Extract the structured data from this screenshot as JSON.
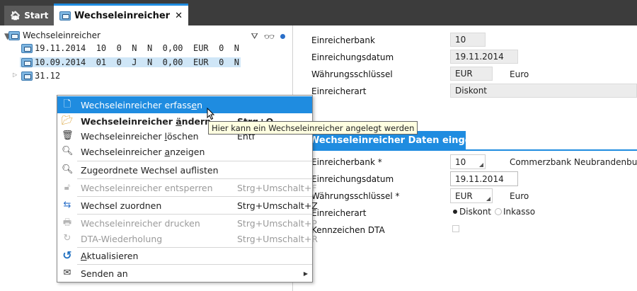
{
  "tabs": {
    "start_label": "Start",
    "active_label": "Wechseleinreicher",
    "close_glyph": "✕"
  },
  "tree": {
    "root_label": "Wechseleinreicher",
    "items": [
      {
        "label": "19.11.2014  10  0  N  N  0,00  EUR  0  N"
      },
      {
        "label": "10.09.2014  01  0  J  N  0,00  EUR  0  N"
      },
      {
        "label": "31.12"
      }
    ]
  },
  "details_top": {
    "bank_label": "Einreicherbank",
    "bank_value": "10",
    "date_label": "Einreichungsdatum",
    "date_value": "19.11.2014",
    "currency_label": "Währungsschlüssel",
    "currency_value": "EUR",
    "currency_name": "Euro",
    "type_label": "Einreicherart",
    "type_value": "Diskont"
  },
  "form": {
    "header": "Wechseleinreicher Daten eingeben",
    "bank_label": "Einreicherbank *",
    "bank_value": "10",
    "bank_name": "Commerzbank Neubrandenburg",
    "date_label": "Einreichungsdatum",
    "date_value": "19.11.2014",
    "currency_label": "Währungsschlüssel *",
    "currency_value": "EUR",
    "currency_name": "Euro",
    "type_label": "Einreicherart",
    "type_option1": "Diskont",
    "type_option2": "Inkasso",
    "dta_label": "Kennzeichen DTA"
  },
  "context_menu": {
    "items": [
      {
        "pre": "Wechseleinreicher erfass",
        "u": "e",
        "post": "n",
        "shortcut": ""
      },
      {
        "pre": "Wechseleinreicher ",
        "u": "ä",
        "post": "ndern",
        "shortcut": "Strg+O"
      },
      {
        "pre": "Wechseleinreicher ",
        "u": "l",
        "post": "öschen",
        "shortcut": "Entf"
      },
      {
        "pre": "Wechseleinreicher ",
        "u": "a",
        "post": "nzeigen",
        "shortcut": ""
      },
      {
        "pre": "Zugeordnete Wechsel auf",
        "u": "l",
        "post": "isten",
        "shortcut": ""
      },
      {
        "pre": "Wechseleinreicher entsperren",
        "u": "",
        "post": "",
        "shortcut": "Strg+Umschalt+F"
      },
      {
        "pre": "Wechsel zuordnen",
        "u": "",
        "post": "",
        "shortcut": "Strg+Umschalt+Z"
      },
      {
        "pre": "Wechseleinreicher drucken",
        "u": "",
        "post": "",
        "shortcut": "Strg+Umschalt+P"
      },
      {
        "pre": "DTA-Wiederholung",
        "u": "",
        "post": "",
        "shortcut": "Strg+Umschalt+R"
      },
      {
        "pre": "",
        "u": "A",
        "post": "ktualisieren",
        "shortcut": ""
      },
      {
        "pre": "Senden an",
        "u": "",
        "post": "",
        "shortcut": ""
      }
    ]
  },
  "tooltip": "Hier kann ein Wechseleinreicher angelegt werden",
  "colors": {
    "accent": "#1f8ce0",
    "tabbar": "#3c3c3c",
    "selection": "#cfe6f7",
    "tooltip_bg": "#ffffe1"
  }
}
